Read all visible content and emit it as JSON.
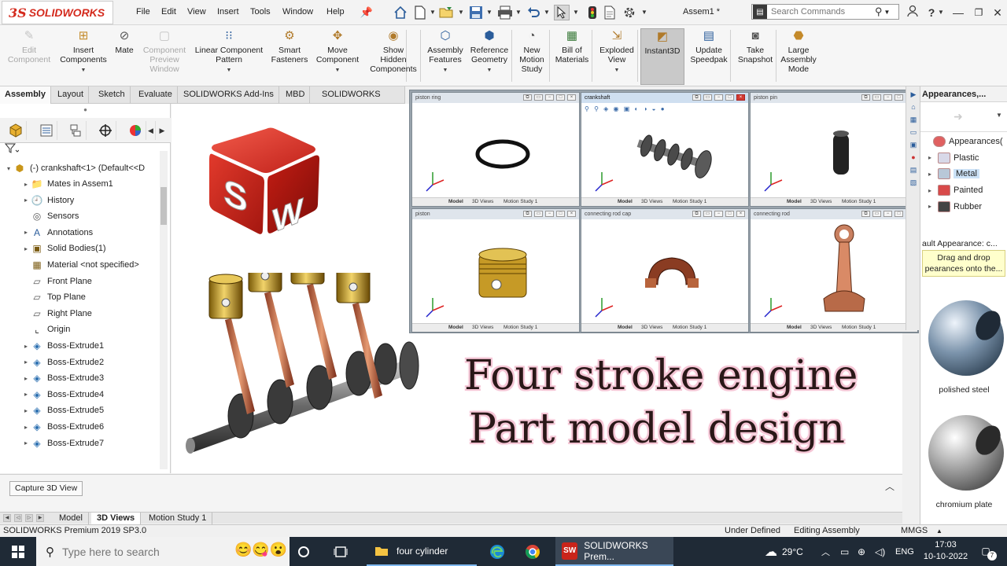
{
  "titlebar": {
    "logo_mark": "3S",
    "logo_text": "SOLIDWORKS",
    "menus": [
      "File",
      "Edit",
      "View",
      "Insert",
      "Tools",
      "Window",
      "Help"
    ],
    "document_title": "Assem1 *",
    "search_placeholder": "Search Commands",
    "help_label": "?",
    "icons": [
      "home-icon",
      "new-icon",
      "open-icon",
      "save-icon",
      "print-icon",
      "undo-icon",
      "select-icon",
      "rebuild-icon",
      "options-icon"
    ]
  },
  "ribbon": {
    "buttons": [
      {
        "label": "Edit\nComponent",
        "icon": "edit-component-icon",
        "enabled": false
      },
      {
        "label": "Insert\nComponents",
        "icon": "insert-components-icon",
        "enabled": true
      },
      {
        "label": "Mate",
        "icon": "mate-icon",
        "enabled": true
      },
      {
        "label": "Component\nPreview\nWindow",
        "icon": "preview-window-icon",
        "enabled": false
      },
      {
        "label": "Linear Component\nPattern",
        "icon": "linear-pattern-icon",
        "enabled": true
      },
      {
        "label": "Smart\nFasteners",
        "icon": "smart-fasteners-icon",
        "enabled": true
      },
      {
        "label": "Move\nComponent",
        "icon": "move-component-icon",
        "enabled": true
      },
      {
        "label": "Show\nHidden\nComponents",
        "icon": "show-hidden-icon",
        "enabled": true
      },
      {
        "label": "Assembly\nFeatures",
        "icon": "assembly-features-icon",
        "enabled": true
      },
      {
        "label": "Reference\nGeometry",
        "icon": "reference-geometry-icon",
        "enabled": true
      },
      {
        "label": "New\nMotion\nStudy",
        "icon": "motion-study-icon",
        "enabled": true
      },
      {
        "label": "Bill of\nMaterials",
        "icon": "bom-icon",
        "enabled": true
      },
      {
        "label": "Exploded\nView",
        "icon": "exploded-view-icon",
        "enabled": true
      },
      {
        "label": "Instant3D",
        "icon": "instant3d-icon",
        "enabled": true,
        "active": true
      },
      {
        "label": "Update\nSpeedpak",
        "icon": "speedpak-icon",
        "enabled": true
      },
      {
        "label": "Take\nSnapshot",
        "icon": "snapshot-icon",
        "enabled": true
      },
      {
        "label": "Large\nAssembly\nMode",
        "icon": "large-assembly-icon",
        "enabled": true
      }
    ]
  },
  "command_tabs": [
    "Assembly",
    "Layout",
    "Sketch",
    "Evaluate",
    "SOLIDWORKS Add-Ins",
    "MBD",
    "SOLIDWORKS CAM"
  ],
  "feature_tree": {
    "root": "(-) crankshaft<1> (Default<<D",
    "items": [
      {
        "label": "Mates in Assem1",
        "icon": "mates-folder-icon",
        "expandable": true
      },
      {
        "label": "History",
        "icon": "history-icon",
        "expandable": true
      },
      {
        "label": "Sensors",
        "icon": "sensors-icon",
        "expandable": false
      },
      {
        "label": "Annotations",
        "icon": "annotations-icon",
        "expandable": true
      },
      {
        "label": "Solid Bodies(1)",
        "icon": "solid-bodies-icon",
        "expandable": true
      },
      {
        "label": "Material <not specified>",
        "icon": "material-icon",
        "expandable": false
      },
      {
        "label": "Front Plane",
        "icon": "plane-icon",
        "expandable": false
      },
      {
        "label": "Top Plane",
        "icon": "plane-icon",
        "expandable": false
      },
      {
        "label": "Right Plane",
        "icon": "plane-icon",
        "expandable": false
      },
      {
        "label": "Origin",
        "icon": "origin-icon",
        "expandable": false
      },
      {
        "label": "Boss-Extrude1",
        "icon": "extrude-icon",
        "expandable": true
      },
      {
        "label": "Boss-Extrude2",
        "icon": "extrude-icon",
        "expandable": true
      },
      {
        "label": "Boss-Extrude3",
        "icon": "extrude-icon",
        "expandable": true
      },
      {
        "label": "Boss-Extrude4",
        "icon": "extrude-icon",
        "expandable": true
      },
      {
        "label": "Boss-Extrude5",
        "icon": "extrude-icon",
        "expandable": true
      },
      {
        "label": "Boss-Extrude6",
        "icon": "extrude-icon",
        "expandable": true
      },
      {
        "label": "Boss-Extrude7",
        "icon": "extrude-icon",
        "expandable": true
      }
    ]
  },
  "graphics": {
    "headline_line1": "Four stroke engine",
    "headline_line2": "Part model design",
    "cube_letters": [
      "S",
      "W"
    ]
  },
  "part_windows": [
    {
      "title": "piston ring",
      "active": false
    },
    {
      "title": "crankshaft",
      "active": true
    },
    {
      "title": "piston pin",
      "active": false
    },
    {
      "title": "piston",
      "active": false
    },
    {
      "title": "connecting rod cap",
      "active": false
    },
    {
      "title": "connecting rod",
      "active": false
    }
  ],
  "part_window_tabs": [
    "Model",
    "3D Views",
    "Motion Study 1"
  ],
  "task_pane": {
    "title": "Appearances,...",
    "tree": [
      {
        "label": "Appearances(",
        "level": 0
      },
      {
        "label": "Plastic",
        "level": 1
      },
      {
        "label": "Metal",
        "level": 1,
        "selected": true
      },
      {
        "label": "Painted",
        "level": 1
      },
      {
        "label": "Rubber",
        "level": 1
      }
    ],
    "caption": "ault Appearance: c...",
    "tooltip": "Drag and drop\npearances onto the...",
    "swatches": [
      "polished steel",
      "chromium plate"
    ]
  },
  "bottom_panel": {
    "capture_label": "Capture 3D View",
    "tabs": [
      "Model",
      "3D Views",
      "Motion Study 1"
    ],
    "active_tab": "3D Views"
  },
  "status_bar": {
    "product": "SOLIDWORKS Premium 2019 SP3.0",
    "state": "Under Defined",
    "mode": "Editing Assembly",
    "units": "MMGS"
  },
  "taskbar": {
    "search_placeholder": "Type here to search",
    "apps": [
      {
        "label": "",
        "icon": "task-view-icon"
      },
      {
        "label": "",
        "icon": "cortana-icon"
      },
      {
        "label": "four cylinder",
        "icon": "folder-icon"
      },
      {
        "label": "",
        "icon": "edge-icon"
      },
      {
        "label": "",
        "icon": "chrome-icon"
      },
      {
        "label": "SOLIDWORKS Prem...",
        "icon": "solidworks-icon"
      }
    ],
    "weather": "29°C",
    "language": "ENG",
    "time": "17:03",
    "date": "10-10-2022",
    "notification_count": "7"
  },
  "colors": {
    "brand_red": "#d42b1e",
    "taskbar": "#1f2a36",
    "headline_text": "#2a1818",
    "headline_glow": "#f4c4d4",
    "tooltip_bg": "#ffffcc"
  }
}
